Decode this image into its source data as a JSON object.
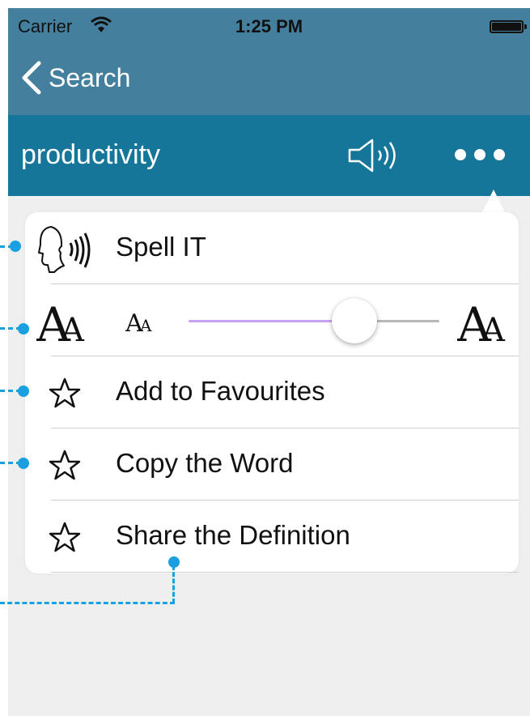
{
  "status_bar": {
    "carrier": "Carrier",
    "time": "1:25 PM"
  },
  "nav_bar": {
    "back_label": "Search"
  },
  "word_bar": {
    "word": "productivity"
  },
  "menu": {
    "spell": {
      "label": "Spell IT",
      "icon": "speaking-head-icon"
    },
    "font_size": {
      "level": 0.66,
      "small_icon": "small-font-icon",
      "large_icon": "large-font-icon"
    },
    "items": [
      {
        "label": "Add to Favourites",
        "icon": "star-icon"
      },
      {
        "label": "Copy the Word",
        "icon": "star-icon"
      },
      {
        "label": "Share the Definition",
        "icon": "star-icon"
      }
    ]
  },
  "colors": {
    "nav_bar": "#447f9e",
    "word_bar": "#16769a",
    "background": "#efefef",
    "callout": "#1aa0e0",
    "slider_fill": "#c9a3f2"
  }
}
